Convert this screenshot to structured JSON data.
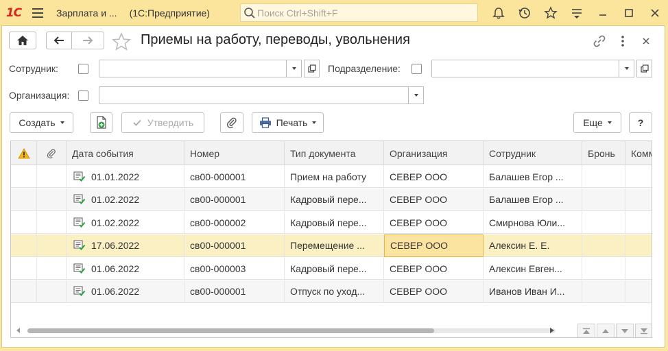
{
  "app": {
    "logo_text": "1С",
    "title_part1": "Зарплата и ...",
    "title_part2": "(1С:Предприятие)",
    "search_placeholder": "Поиск Ctrl+Shift+F"
  },
  "titlebar_icons": [
    "bell-icon",
    "history-icon",
    "favorites-star-icon",
    "settings-menu-icon",
    "minimize-icon",
    "maximize-icon",
    "close-icon"
  ],
  "form": {
    "title": "Приемы на работу, переводы, увольнения"
  },
  "filters": {
    "employee_label": "Сотрудник:",
    "department_label": "Подразделение:",
    "organization_label": "Организация:",
    "employee_value": "",
    "department_value": "",
    "organization_value": ""
  },
  "toolbar": {
    "create_label": "Создать",
    "approve_label": "Утвердить",
    "print_label": "Печать",
    "more_label": "Еще",
    "help_label": "?"
  },
  "table": {
    "columns": [
      "",
      "",
      "Дата события",
      "Номер",
      "Тип документа",
      "Организация",
      "Сотрудник",
      "Бронь",
      "Комм"
    ],
    "rows": [
      {
        "date": "01.01.2022",
        "number": "св00-000001",
        "doc_type": "Прием на работу",
        "org": "СЕВЕР ООО",
        "employee": "Балашев Егор ..."
      },
      {
        "date": "01.02.2022",
        "number": "св00-000001",
        "doc_type": "Кадровый пере...",
        "org": "СЕВЕР ООО",
        "employee": "Балашев Егор ..."
      },
      {
        "date": "01.02.2022",
        "number": "св00-000002",
        "doc_type": "Кадровый пере...",
        "org": "СЕВЕР ООО",
        "employee": "Смирнова Юли..."
      },
      {
        "date": "17.06.2022",
        "number": "св00-000001",
        "doc_type": "Перемещение ...",
        "org": "СЕВЕР ООО",
        "employee": "Алексин Е. Е."
      },
      {
        "date": "01.06.2022",
        "number": "св00-000003",
        "doc_type": "Кадровый пере...",
        "org": "СЕВЕР ООО",
        "employee": "Алексин Евген..."
      },
      {
        "date": "01.06.2022",
        "number": "св00-000001",
        "doc_type": "Отпуск по уход...",
        "org": "СЕВЕР ООО",
        "employee": "Иванов Иван И..."
      }
    ]
  },
  "colors": {
    "titlebar_bg": "#fbe49b",
    "selected_row": "#fbefc4",
    "current_cell": "#fbe3a0",
    "logo_red": "#d7261e",
    "posted_green": "#2ea043"
  }
}
